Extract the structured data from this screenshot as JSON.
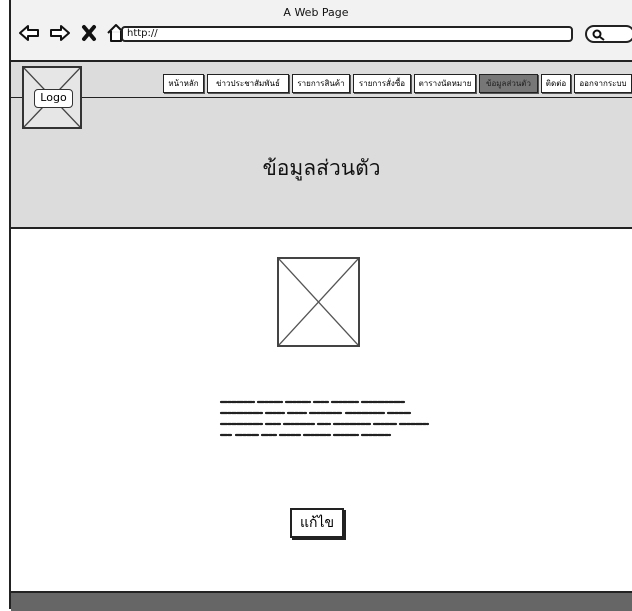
{
  "window": {
    "title": "A Web Page"
  },
  "browser": {
    "url": "http://"
  },
  "logo": {
    "label": "Logo"
  },
  "menu": {
    "items": [
      {
        "label": "หน้าหลัก"
      },
      {
        "label": "ข่าวประชาสัมพันธ์"
      },
      {
        "label": "รายการสินค้า"
      },
      {
        "label": "รายการสั่งซื้อ"
      },
      {
        "label": "ตารางนัดหมาย"
      },
      {
        "label": "ข้อมูลส่วนตัว"
      },
      {
        "label": "ติดต่อ"
      },
      {
        "label": "ออกจากระบบ"
      }
    ],
    "active_index": 5
  },
  "page": {
    "heading": "ข้อมูลส่วนตัว"
  },
  "profile": {
    "edit_label": "แก้ไข"
  }
}
